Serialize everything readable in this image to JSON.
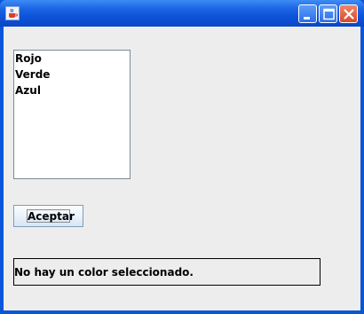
{
  "window": {
    "title": "",
    "icon": "java-cup-icon",
    "controls": [
      "minimize-icon",
      "maximize-icon",
      "close-icon"
    ]
  },
  "list": {
    "items": [
      "Rojo",
      "Verde",
      "Azul"
    ]
  },
  "accept_button": {
    "label": "Aceptar"
  },
  "status": {
    "text": "No hay un color seleccionado."
  }
}
